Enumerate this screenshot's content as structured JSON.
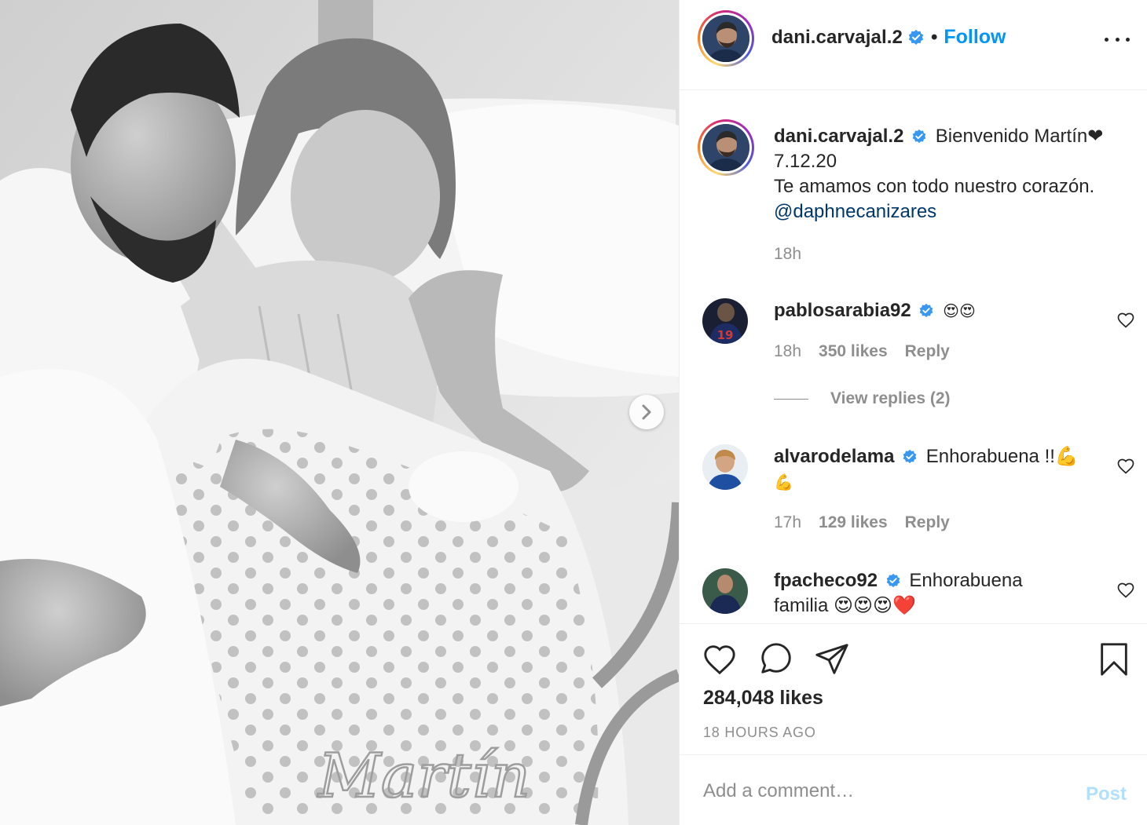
{
  "post": {
    "author": "dani.carvajal.2",
    "follow_label": "Follow",
    "separator": "•",
    "caption_line1": "Bienvenido Martín❤",
    "caption_line2": "7.12.20",
    "caption_line3": "Te amamos con todo nuestro corazón.",
    "caption_mention": "@daphnecanizares",
    "caption_time": "18h",
    "likes": "284,048 likes",
    "posted_ago": "18 HOURS AGO",
    "photo_text": "Martín"
  },
  "comments": [
    {
      "user": "pablosarabia92",
      "text": "😍😍",
      "time": "18h",
      "likes": "350 likes",
      "reply": "Reply",
      "view_replies": "View replies (2)"
    },
    {
      "user": "alvarodelama",
      "text": "Enhorabuena !!💪",
      "text_wrap": "💪",
      "time": "17h",
      "likes": "129 likes",
      "reply": "Reply"
    },
    {
      "user": "fpacheco92",
      "text": "Enhorabuena",
      "text_wrap": "familia 😍😍😍❤️"
    }
  ],
  "comment_box": {
    "placeholder": "Add a comment…",
    "post_label": "Post"
  },
  "icons": {
    "like": "heart-icon",
    "comment": "comment-bubble-icon",
    "share": "paper-plane-icon",
    "save": "bookmark-icon",
    "more": "more-options-icon",
    "next": "chevron-right-icon",
    "verified": "verified-badge-icon"
  },
  "colors": {
    "link": "#0095f6",
    "mention": "#00376b",
    "secondary_text": "#8e8e8e",
    "verified": "#3897f0"
  }
}
